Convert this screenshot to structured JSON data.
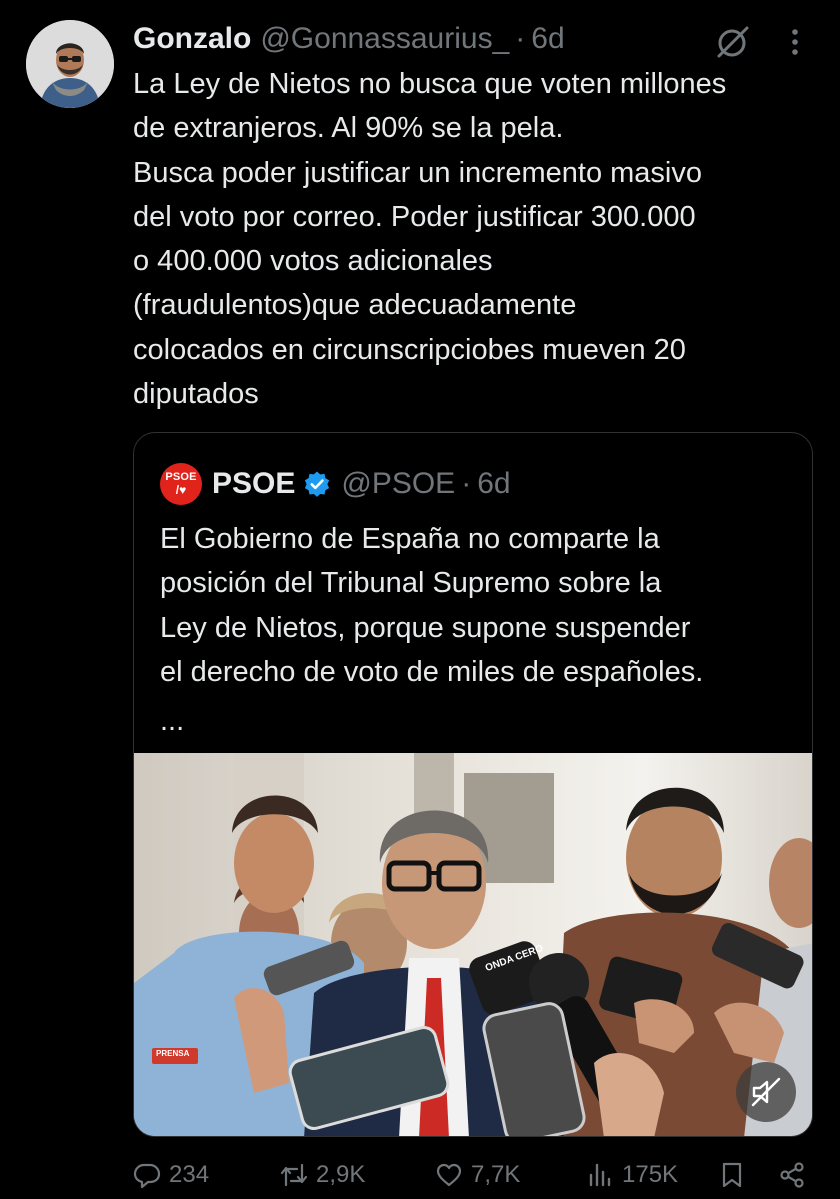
{
  "tweet": {
    "author_name": "Gonzalo",
    "author_handle": "@Gonnassaurius_",
    "separator": "·",
    "time": "6d",
    "text": "La Ley de Nietos no busca que voten millones\nde extranjeros. Al 90% se la pela.\nBusca poder justificar un incremento masivo\ndel voto por correo. Poder justificar 300.000\no 400.000 votos adicionales\n(fraudulentos)que adecuadamente\ncolocados en circunscripciobes mueven 20\ndiputados"
  },
  "quoted": {
    "logo_text_top": "PSOE",
    "logo_text_bottom": "/♥",
    "author_name": "PSOE",
    "author_handle": "@PSOE",
    "separator": "·",
    "time": "6d",
    "text": "El Gobierno de España no comparte la\nposición del Tribunal Supremo sobre la\nLey de Nietos, porque supone suspender\nel derecho de voto de miles de españoles.",
    "ellipsis": "...",
    "media": {
      "microphone_label": "ONDA CERO",
      "badge_text": "PRENSA"
    }
  },
  "actions": {
    "replies": "234",
    "reposts": "2,9K",
    "likes": "7,7K",
    "views": "175K"
  },
  "icons": {
    "header": [
      "avatar",
      "grok-icon",
      "more-icon"
    ],
    "quoted": [
      "psoe-logo",
      "verified-icon",
      "mute-icon"
    ],
    "actions": [
      "reply-icon",
      "repost-icon",
      "like-icon",
      "views-icon",
      "bookmark-icon",
      "share-icon"
    ]
  },
  "colors": {
    "background": "#000000",
    "text": "#e7e9ea",
    "secondary": "#71767b",
    "border": "#2f3336",
    "verified": "#1d9bf0",
    "psoe_red": "#e1241b"
  }
}
